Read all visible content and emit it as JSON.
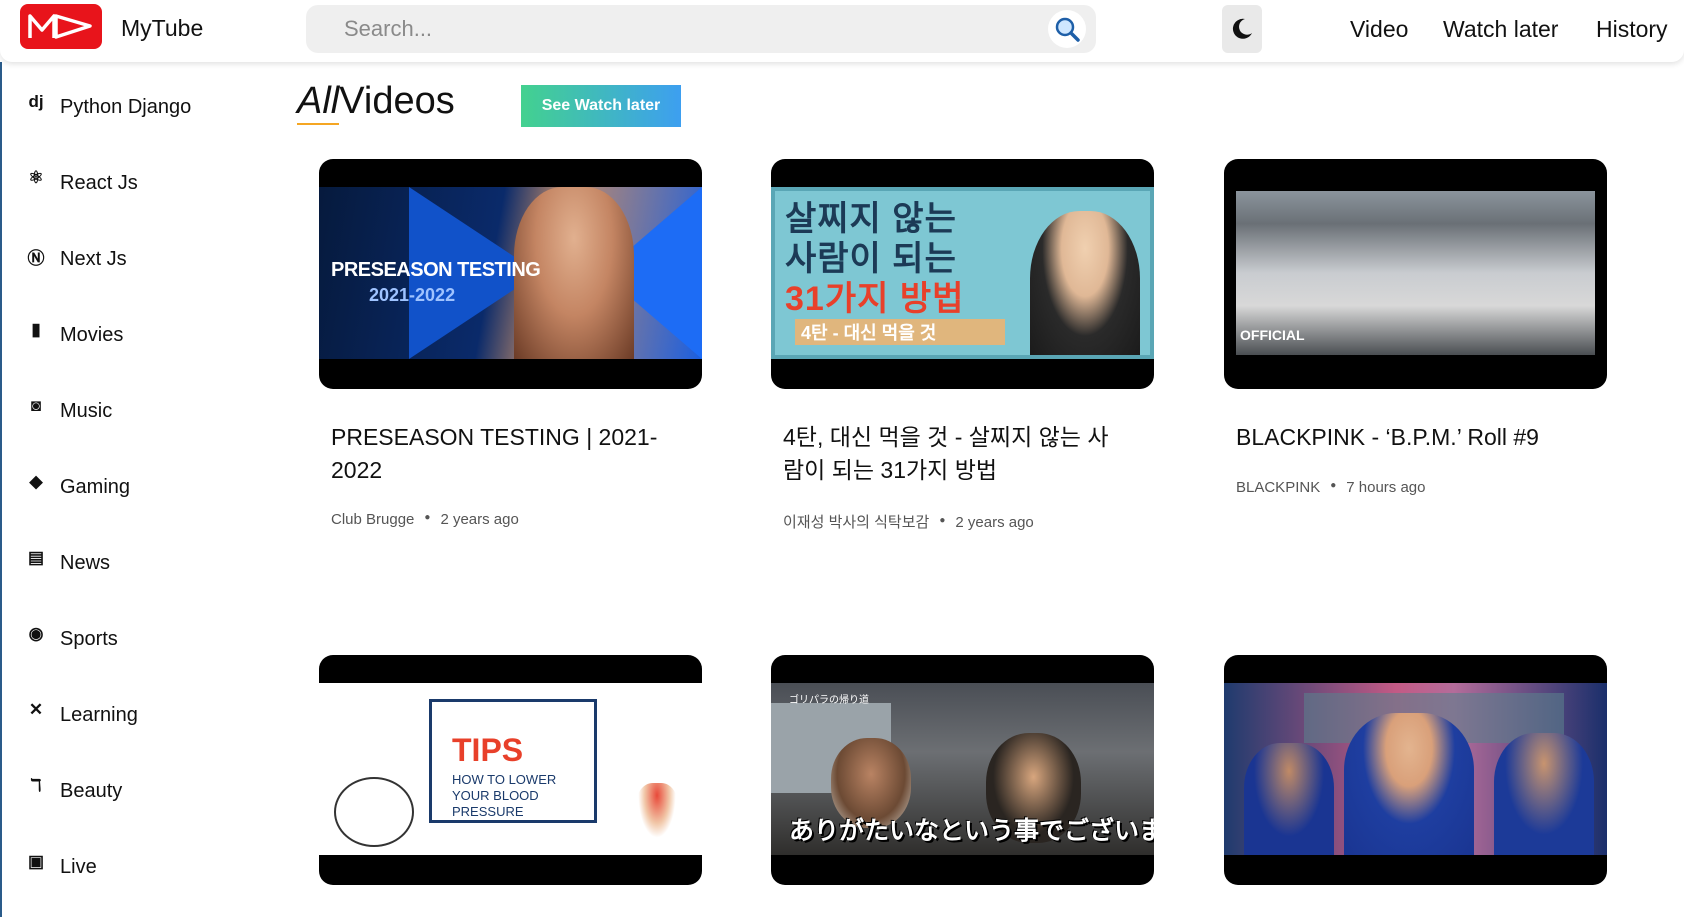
{
  "header": {
    "brand": "MyTube",
    "search_placeholder": "Search...",
    "nav": {
      "video": "Video",
      "watch_later": "Watch later",
      "history": "History"
    }
  },
  "sidebar": {
    "items": [
      {
        "label": "Python Django",
        "icon": "django-icon"
      },
      {
        "label": "React Js",
        "icon": "react-icon"
      },
      {
        "label": "Next Js",
        "icon": "nextjs-icon"
      },
      {
        "label": "Movies",
        "icon": "film-icon"
      },
      {
        "label": "Music",
        "icon": "music-icon"
      },
      {
        "label": "Gaming",
        "icon": "gamepad-icon"
      },
      {
        "label": "News",
        "icon": "newspaper-icon"
      },
      {
        "label": "Sports",
        "icon": "broadcast-icon"
      },
      {
        "label": "Learning",
        "icon": "tools-icon"
      },
      {
        "label": "Beauty",
        "icon": "hair-dryer-icon"
      },
      {
        "label": "Live",
        "icon": "tv-icon"
      }
    ]
  },
  "main": {
    "heading_all": "All",
    "heading_rest": "Videos",
    "see_watch_later": "See Watch later",
    "videos": [
      {
        "title": "PRESEASON TESTING | 2021-2022",
        "channel": "Club Brugge",
        "age": "2 years ago",
        "thumb_text1": "PRESEASON TESTING",
        "thumb_text2": "2021-2022"
      },
      {
        "title": "4탄, 대신 먹을 것 - 살찌지 않는 사람이 되는 31가지 방법",
        "channel": "이재성 박사의 식탁보감",
        "age": "2 years ago",
        "thumb_text1": "살찌지 않는",
        "thumb_text2": "사람이 되는",
        "thumb_text3": "31가지 방법",
        "thumb_text4": "4탄 - 대신 먹을 것"
      },
      {
        "title": "BLACKPINK - ‘B.P.M.’ Roll #9",
        "channel": "BLACKPINK",
        "age": "7 hours ago",
        "thumb_text1": "OFFICIAL"
      },
      {
        "thumb_text1": "TIPS",
        "thumb_text2": "HOW TO LOWER YOUR BLOOD PRESSURE"
      },
      {
        "thumb_text1": "ありがたいなという事でございます",
        "thumb_text2": "ゴリパラの帰り道"
      },
      {}
    ]
  },
  "colors": {
    "logo": "#e8141b",
    "accent_underline": "#f5a623",
    "button_gradient_start": "#43d18f",
    "button_gradient_end": "#3d9ff0"
  }
}
